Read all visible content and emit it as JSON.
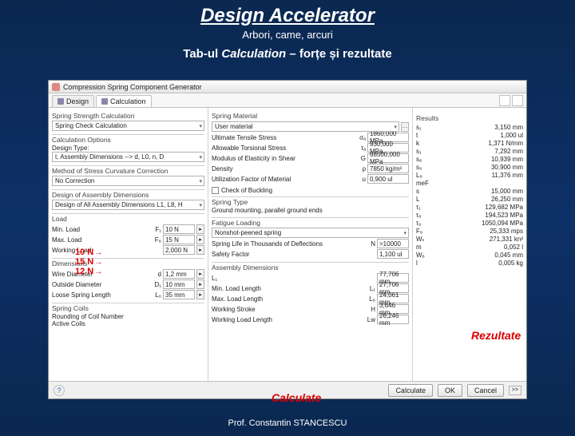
{
  "slide": {
    "title": "Design Accelerator",
    "subtitle": "Arbori, came, arcuri",
    "tabline_pre": "Tab-ul ",
    "tabline_em": "Calculation",
    "tabline_post": " – forțe și rezultate",
    "footer": "Prof. Constantin STANCESCU"
  },
  "window": {
    "title": "Compression Spring Component Generator",
    "tabs": {
      "design": "Design",
      "calculation": "Calculation"
    }
  },
  "annotations": {
    "load_min": "10 N",
    "load_max": "15 N",
    "load_work": "12 N",
    "calculate": "Calculate",
    "rezultate": "Rezultate"
  },
  "col1": {
    "springStrength": {
      "header": "Spring Strength Calculation",
      "select": "Spring Check Calculation"
    },
    "calcOptions": {
      "header": "Calculation Options",
      "designTypeLbl": "Design Type:",
      "designTypeSel": "t, Assembly Dimensions --> d, L0, n, D"
    },
    "curvature": {
      "header": "Method of Stress Curvature Correction",
      "select": "No Correction"
    },
    "assemblyDesign": {
      "header": "Design of Assembly Dimensions",
      "select": "Design of All Assembly Dimensions L1, L8, H"
    },
    "load": {
      "header": "Load",
      "min": {
        "lbl": "Min. Load",
        "sym": "F₁",
        "val": "10 N"
      },
      "max": {
        "lbl": "Max. Load",
        "sym": "F₈",
        "val": "15 N"
      },
      "work": {
        "lbl": "Working Load",
        "val": "2,000 N"
      }
    },
    "dims": {
      "header": "Dimensions",
      "wire": {
        "lbl": "Wire Diameter",
        "sym": "d",
        "val": "1,2 mm"
      },
      "od": {
        "lbl": "Outside Diameter",
        "sym": "D₁",
        "val": "10 mm"
      },
      "len": {
        "lbl": "Loose Spring Length",
        "sym": "L₀",
        "val": "35 mm"
      }
    },
    "coils": {
      "header": "Spring Coils",
      "rounding": "Rounding of Coil Number",
      "active": "Active Coils"
    }
  },
  "col2": {
    "material": {
      "header": "Spring Material",
      "select": "User material",
      "uts": {
        "lbl": "Ultimate Tensile Stress",
        "sym": "σₐ",
        "val": "1860,000 MPa"
      },
      "ats": {
        "lbl": "Allowable Torsional Stress",
        "sym": "τₐ",
        "val": "930,000 MPa"
      },
      "mod": {
        "lbl": "Modulus of Elasticity in Shear",
        "sym": "G",
        "val": "68500,000 MPa"
      },
      "density": {
        "lbl": "Density",
        "sym": "ρ",
        "val": "7850 kg/m³"
      },
      "util": {
        "lbl": "Utilization Factor of Material",
        "sym": "u",
        "val": "0,900 ul"
      }
    },
    "buckling": {
      "check": "Check of Buckling"
    },
    "springType": {
      "header": "Spring Type",
      "text": "Ground mounting, parallel ground ends"
    },
    "fatigue": {
      "header": "Fatigue Loading",
      "select": "Nonshot-peened spring",
      "life": {
        "lbl": "Spring Life in Thousands of Deflections",
        "sym": "N",
        "val": ">10000"
      },
      "safety": {
        "lbl": "Safety Factor",
        "val": "1,100 ul"
      }
    },
    "assembly": {
      "header": "Assembly Dimensions",
      "l1": {
        "sym": "L₁  ",
        "val": "77,706 mm"
      },
      "minLoad": {
        "lbl": "Min. Load Length",
        "sym": "L₁",
        "val": "27,706 mm"
      },
      "maxLoad": {
        "lbl": "Max. Load Length",
        "sym": "L₈",
        "val": "24,061 mm"
      },
      "stroke": {
        "lbl": "Working Stroke",
        "sym": "H",
        "val": "3,646 mm"
      },
      "workLen": {
        "lbl": "Working Load Length",
        "sym": "Lw",
        "val": "26,246 mm"
      }
    }
  },
  "results": {
    "header": "Results",
    "rows": [
      {
        "k": "s₁",
        "v": "3,150 mm"
      },
      {
        "k": "t",
        "v": "1,000 ul"
      },
      {
        "k": "k",
        "v": "1,371 N/mm"
      },
      {
        "k": "s₁",
        "v": "7,292 mm"
      },
      {
        "k": "s₈",
        "v": "10,939 mm"
      },
      {
        "k": "s₉",
        "v": "30,900 mm"
      },
      {
        "k": "L₉",
        "v": "11,376 mm"
      },
      {
        "k": "meF",
        "v": ""
      },
      {
        "k": "s",
        "v": "15,000 mm"
      },
      {
        "k": "L",
        "v": "26,250 mm"
      },
      {
        "k": "τ₁",
        "v": "129,682 MPa"
      },
      {
        "k": "τ₈",
        "v": "194,523 MPa"
      },
      {
        "k": "τ₉",
        "v": "1050,094 MPa"
      },
      {
        "k": "F₉",
        "v": "25,333 mps"
      },
      {
        "k": "Wₛ",
        "v": "271,331 kn²"
      },
      {
        "k": "m",
        "v": "0,052 l"
      },
      {
        "k": "W₈",
        "v": "0,045 mm"
      },
      {
        "k": "l",
        "v": "0,005 kg"
      }
    ]
  },
  "buttons": {
    "calculate": "Calculate",
    "ok": "OK",
    "cancel": "Cancel"
  },
  "chev": ">>"
}
